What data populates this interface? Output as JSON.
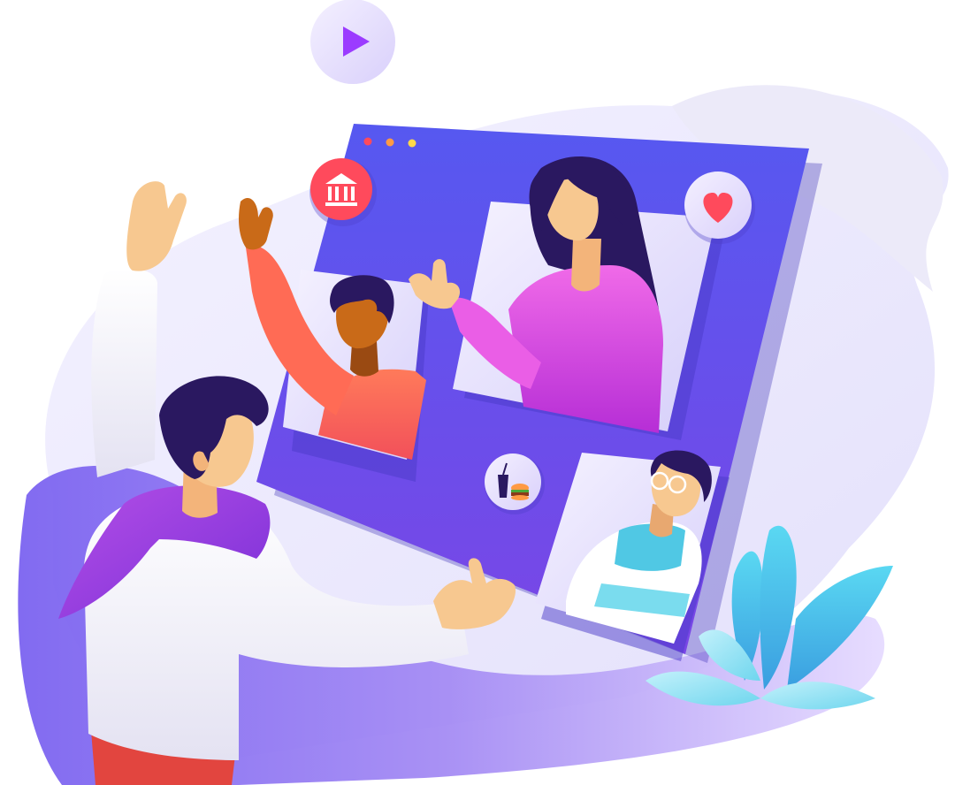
{
  "scene": {
    "kind": "video-conference-illustration",
    "participant_count": 4,
    "icons": [
      "play-icon",
      "bank-icon",
      "heart-icon",
      "food-drink-icon"
    ],
    "window_controls": [
      "close-dot",
      "minimize-dot",
      "maximize-dot"
    ]
  },
  "colors": {
    "screen": "#5a4de8",
    "screen_dark": "#4b3fd4",
    "accent_red": "#ff4a5c",
    "accent_orange": "#ff9a44",
    "accent_pink": "#e04be0",
    "accent_cyan": "#46d2ee",
    "skin_light": "#f7c890",
    "skin_dark": "#c96a18",
    "hair": "#2a1860",
    "blob_lavender": "#d9d4f7"
  }
}
